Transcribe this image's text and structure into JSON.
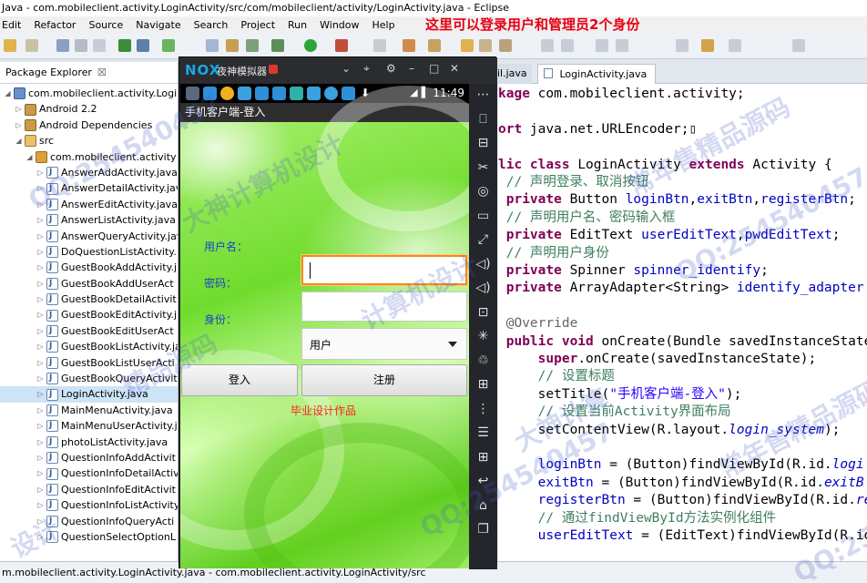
{
  "window": {
    "title": "Java - com.mobileclient.activity.LoginActivity/src/com/mobileclient/activity/LoginActivity.java - Eclipse"
  },
  "menubar": {
    "items": [
      "Edit",
      "Refactor",
      "Source",
      "Navigate",
      "Search",
      "Project",
      "Run",
      "Window",
      "Help"
    ]
  },
  "annotation": "这里可以登录用户和管理员2个身份",
  "package_explorer": {
    "tab_label": "Package Explorer",
    "close_glyph": "☒",
    "tree": [
      {
        "label": "com.mobileclient.activity.LoginAc",
        "icon": "project-icon",
        "level": 0,
        "expanded": true
      },
      {
        "label": "Android 2.2",
        "icon": "library-icon",
        "level": 1,
        "expanded": false
      },
      {
        "label": "Android Dependencies",
        "icon": "library-icon",
        "level": 1,
        "expanded": false
      },
      {
        "label": "src",
        "icon": "source-folder-icon",
        "level": 1,
        "expanded": true
      },
      {
        "label": "com.mobileclient.activity",
        "icon": "package-icon",
        "level": 2,
        "expanded": true
      },
      {
        "label": "AnswerAddActivity.java",
        "icon": "java-file-icon",
        "level": 3
      },
      {
        "label": "AnswerDetailActivity.jav",
        "icon": "java-file-icon",
        "level": 3
      },
      {
        "label": "AnswerEditActivity.java",
        "icon": "java-file-icon",
        "level": 3
      },
      {
        "label": "AnswerListActivity.java",
        "icon": "java-file-icon",
        "level": 3
      },
      {
        "label": "AnswerQueryActivity.jav",
        "icon": "java-file-icon",
        "level": 3
      },
      {
        "label": "DoQuestionListActivity.",
        "icon": "java-file-icon",
        "level": 3
      },
      {
        "label": "GuestBookAddActivity.j",
        "icon": "java-file-icon",
        "level": 3
      },
      {
        "label": "GuestBookAddUserAct",
        "icon": "java-file-icon",
        "level": 3
      },
      {
        "label": "GuestBookDetailActivit",
        "icon": "java-file-icon",
        "level": 3
      },
      {
        "label": "GuestBookEditActivity.j",
        "icon": "java-file-icon",
        "level": 3
      },
      {
        "label": "GuestBookEditUserAct",
        "icon": "java-file-icon",
        "level": 3
      },
      {
        "label": "GuestBookListActivity.ja",
        "icon": "java-file-icon",
        "level": 3
      },
      {
        "label": "GuestBookListUserActi",
        "icon": "java-file-icon",
        "level": 3
      },
      {
        "label": "GuestBookQueryActivit",
        "icon": "java-file-icon",
        "level": 3
      },
      {
        "label": "LoginActivity.java",
        "icon": "java-file-icon",
        "level": 3,
        "selected": true
      },
      {
        "label": "MainMenuActivity.java",
        "icon": "java-file-icon",
        "level": 3
      },
      {
        "label": "MainMenuUserActivity.j",
        "icon": "java-file-icon",
        "level": 3
      },
      {
        "label": "photoListActivity.java",
        "icon": "java-file-icon",
        "level": 3
      },
      {
        "label": "QuestionInfoAddActivit",
        "icon": "java-file-icon",
        "level": 3
      },
      {
        "label": "QuestionInfoDetailActiv",
        "icon": "java-file-icon",
        "level": 3
      },
      {
        "label": "QuestionInfoEditActivit",
        "icon": "java-file-icon",
        "level": 3
      },
      {
        "label": "QuestionInfoListActivity",
        "icon": "java-file-icon",
        "level": 3
      },
      {
        "label": "QuestionInfoQueryActi",
        "icon": "java-file-icon",
        "level": 3
      },
      {
        "label": "QuestionSelectOptionL",
        "icon": "java-file-icon",
        "level": 3
      }
    ]
  },
  "editor": {
    "tabs": [
      {
        "label": "ttpUtil.java",
        "active": false
      },
      {
        "label": "LoginActivity.java",
        "active": true,
        "close_glyph": "☒"
      }
    ],
    "code_lines": [
      [
        {
          "t": "kage ",
          "c": "kw"
        },
        {
          "t": "com.mobileclient.activity;",
          "c": ""
        }
      ],
      [
        {
          "t": "",
          "c": ""
        }
      ],
      [
        {
          "t": "ort ",
          "c": "kw"
        },
        {
          "t": "java.net.URLEncoder;",
          "c": ""
        },
        {
          "t": "▯",
          "c": ""
        }
      ],
      [
        {
          "t": "",
          "c": ""
        }
      ],
      [
        {
          "t": "lic ",
          "c": "kw"
        },
        {
          "t": "class ",
          "c": "kw"
        },
        {
          "t": "LoginActivity ",
          "c": ""
        },
        {
          "t": "extends ",
          "c": "kw"
        },
        {
          "t": "Activity {",
          "c": ""
        }
      ],
      [
        {
          "t": " // 声明登录、取消按钮",
          "c": "cm"
        }
      ],
      [
        {
          "t": " private ",
          "c": "kw"
        },
        {
          "t": "Button ",
          "c": ""
        },
        {
          "t": "loginBtn",
          "c": "fd"
        },
        {
          "t": ",",
          "c": ""
        },
        {
          "t": "exitBtn",
          "c": "fd"
        },
        {
          "t": ",",
          "c": ""
        },
        {
          "t": "registerBtn",
          "c": "fd"
        },
        {
          "t": ";",
          "c": ""
        }
      ],
      [
        {
          "t": " // 声明用户名、密码输入框",
          "c": "cm"
        }
      ],
      [
        {
          "t": " private ",
          "c": "kw"
        },
        {
          "t": "EditText ",
          "c": ""
        },
        {
          "t": "userEditText",
          "c": "fd"
        },
        {
          "t": ",",
          "c": ""
        },
        {
          "t": "pwdEditText",
          "c": "fd"
        },
        {
          "t": ";",
          "c": ""
        }
      ],
      [
        {
          "t": " // 声明用户身份",
          "c": "cm"
        }
      ],
      [
        {
          "t": " private ",
          "c": "kw"
        },
        {
          "t": "Spinner ",
          "c": ""
        },
        {
          "t": "spinner_identify",
          "c": "fd"
        },
        {
          "t": ";",
          "c": ""
        }
      ],
      [
        {
          "t": " private ",
          "c": "kw"
        },
        {
          "t": "ArrayAdapter<String> ",
          "c": ""
        },
        {
          "t": "identify_adapter",
          "c": "fd"
        }
      ],
      [
        {
          "t": "",
          "c": ""
        }
      ],
      [
        {
          "t": " @Override",
          "c": "an"
        }
      ],
      [
        {
          "t": " public ",
          "c": "kw"
        },
        {
          "t": "void ",
          "c": "kw"
        },
        {
          "t": "onCreate(Bundle savedInstanceState",
          "c": ""
        }
      ],
      [
        {
          "t": "     super",
          "c": "kw"
        },
        {
          "t": ".onCreate(savedInstanceState);",
          "c": ""
        }
      ],
      [
        {
          "t": "     // 设置标题",
          "c": "cm"
        }
      ],
      [
        {
          "t": "     setTitle(",
          "c": ""
        },
        {
          "t": "\"手机客户端-登入\"",
          "c": "st"
        },
        {
          "t": ");",
          "c": ""
        }
      ],
      [
        {
          "t": "     // 设置当前Activity界面布局",
          "c": "cm"
        }
      ],
      [
        {
          "t": "     setContentView(R.layout.",
          "c": ""
        },
        {
          "t": "login_system",
          "c": "it"
        },
        {
          "t": ");",
          "c": ""
        }
      ],
      [
        {
          "t": "",
          "c": ""
        }
      ],
      [
        {
          "t": "     loginBtn",
          "c": "fd"
        },
        {
          "t": " = (Button)findViewById(R.id.",
          "c": ""
        },
        {
          "t": "logi",
          "c": "it"
        }
      ],
      [
        {
          "t": "     exitBtn",
          "c": "fd"
        },
        {
          "t": " = (Button)findViewById(R.id.",
          "c": ""
        },
        {
          "t": "exitB",
          "c": "it"
        }
      ],
      [
        {
          "t": "     registerBtn",
          "c": "fd"
        },
        {
          "t": " = (Button)findViewById(R.id.",
          "c": ""
        },
        {
          "t": "re",
          "c": "it"
        }
      ],
      [
        {
          "t": "     // 通过findViewById方法实例化组件",
          "c": "cm"
        }
      ],
      [
        {
          "t": "     userEditText",
          "c": "fd"
        },
        {
          "t": " = (EditText)findViewById(R.id",
          "c": ""
        }
      ]
    ]
  },
  "statusbar": "m.mobileclient.activity.LoginActivity.java - com.mobileclient.activity.LoginActivity/src",
  "emulator": {
    "logo": "NOX",
    "name": "夜神模拟器",
    "window_controls": [
      "⌄",
      "⌖",
      "⚙",
      "–",
      "□",
      "✕"
    ],
    "clock": "11:49",
    "signal_text": "◢▐",
    "app_title": "手机客户端-登入",
    "username_label": "用户名：",
    "password_label": "密码：",
    "identity_label": "身份：",
    "identity_selected": "用户",
    "login_button": "登入",
    "register_button": "注册",
    "footer_text": "毕业设计作品",
    "sidebar_glyphs": [
      "⋯",
      "⎕",
      "⊟",
      "✂",
      "◎",
      "▭",
      "⤢",
      "◁)",
      "◁)",
      "⊡",
      "✳",
      "♲",
      "⊞",
      "⋮",
      "☰",
      "⊞",
      "↩",
      "⌂",
      "❐"
    ]
  },
  "watermarks": [
    "QQ:254540457",
    "大神计算机设计",
    "常年售精品源码",
    "QQ:254540457",
    "计算机设计",
    "精品源码",
    "QQ:254540457",
    "大神计算",
    "常年售精品源码",
    "QQ:254540457",
    "设计"
  ],
  "colors": {
    "annotation": "#e60012",
    "focus_border": "#f28a1c",
    "label_blue": "#1a3fcf",
    "footer_red": "#ff2020",
    "keyword": "#7f0055",
    "comment": "#3f7f5f",
    "field": "#0000c0"
  }
}
